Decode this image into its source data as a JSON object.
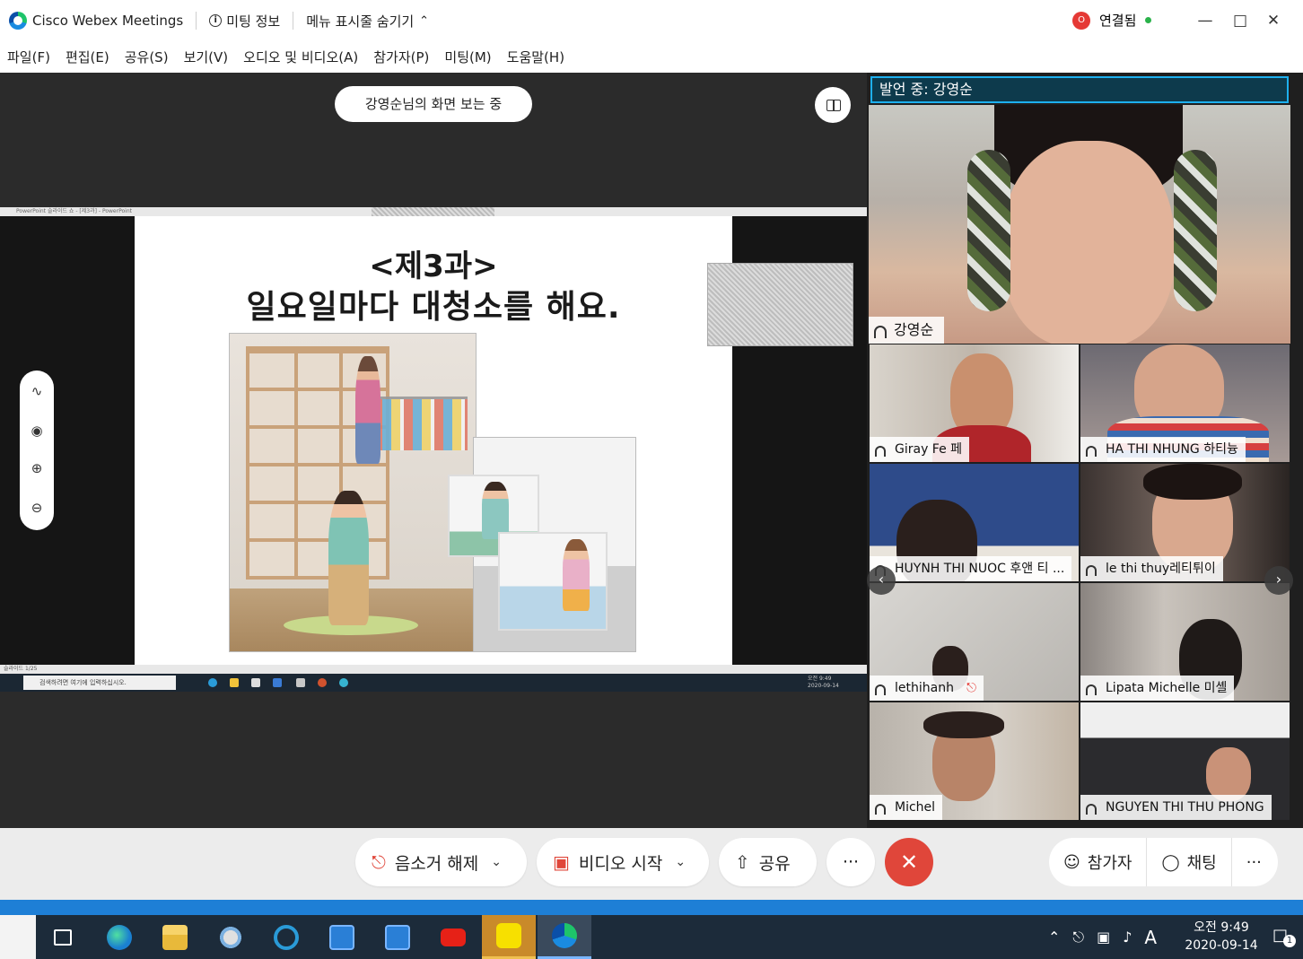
{
  "titlebar": {
    "app_title": "Cisco Webex Meetings",
    "meeting_info": "미팅 정보",
    "hide_menu": "메뉴 표시줄 숨기기",
    "rec_badge": "O",
    "status": "연결됨"
  },
  "menu": [
    "파일(F)",
    "편집(E)",
    "공유(S)",
    "보기(V)",
    "오디오 및 비디오(A)",
    "참가자(P)",
    "미팅(M)",
    "도움말(H)"
  ],
  "share": {
    "viewing": "강영순님의 화면 보는 중",
    "ppt_title": "PowerPoint 슬라이드 쇼 - [제3과] - PowerPoint",
    "slide_line1": "<제3과>",
    "slide_line2": "일요일마다 대청소를 해요.",
    "status_left": "슬라이드 1/25",
    "search_placeholder": "검색하려면 여기에 입력하십시오.",
    "mini_clock": "오전 9:49 2020-09-14"
  },
  "speaker": {
    "bar": "발언 중: 강영순",
    "name": "강영순"
  },
  "participants": [
    {
      "name": "Giray Fe 페"
    },
    {
      "name": "HA THI NHUNG 하티늉"
    },
    {
      "name": "HUYNH THI NUOC 후앤 티 ..."
    },
    {
      "name": "le thi thuy레티튀이"
    },
    {
      "name": "lethihanh"
    },
    {
      "name": "Lipata Michelle 미셸"
    },
    {
      "name": "Michel"
    },
    {
      "name": "NGUYEN THI THU PHONG"
    }
  ],
  "controls": {
    "unmute": "음소거 해제",
    "start_video": "비디오 시작",
    "share": "공유",
    "more": "···",
    "participants": "참가자",
    "chat": "채팅",
    "more_right": "···"
  },
  "taskbar": {
    "time": "오전 9:49",
    "date": "2020-09-14",
    "ime": "A",
    "notif_count": "1"
  },
  "colors": {
    "accent": "#1db0ef",
    "end_call": "#e0463a",
    "connected": "#2ab24a"
  }
}
